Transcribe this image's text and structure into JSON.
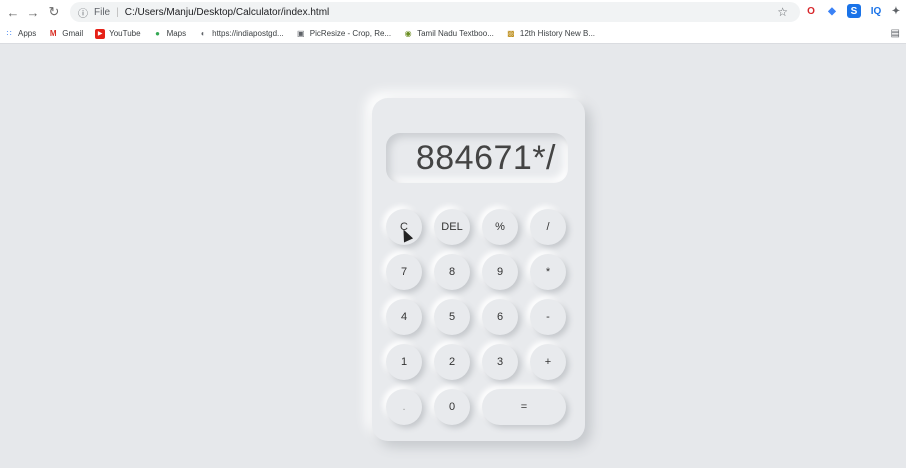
{
  "browser": {
    "file_label": "File",
    "url": "C:/Users/Manju/Desktop/Calculator/index.html",
    "bookmarks": [
      {
        "label": "Apps",
        "icon": "apps-grid-icon"
      },
      {
        "label": "Gmail",
        "icon": "gmail-icon"
      },
      {
        "label": "YouTube",
        "icon": "youtube-icon"
      },
      {
        "label": "Maps",
        "icon": "maps-icon"
      },
      {
        "label": "https://indiapostgd...",
        "icon": "globe-icon"
      },
      {
        "label": "PicResize - Crop, Re...",
        "icon": "picresize-icon"
      },
      {
        "label": "Tamil Nadu Textboo...",
        "icon": "tn-emblem-icon"
      },
      {
        "label": "12th History New B...",
        "icon": "book-icon"
      }
    ],
    "extensions": [
      {
        "label": "O",
        "icon": "opera-icon",
        "color": "#d7262b"
      },
      {
        "label": "◆",
        "icon": "gem-extension-icon",
        "color": "#3b82f6"
      },
      {
        "label": "S",
        "icon": "screenshot-extension-icon",
        "color": "#1a73e8"
      },
      {
        "label": "IQ",
        "icon": "iq-extension-icon",
        "color": "#1a73e8"
      },
      {
        "label": "✦",
        "icon": "puzzle-extensions-icon",
        "color": "#5f6368"
      }
    ]
  },
  "calculator": {
    "display": "884671*/",
    "keys": {
      "clear": "C",
      "del": "DEL",
      "percent": "%",
      "divide": "/",
      "seven": "7",
      "eight": "8",
      "nine": "9",
      "multiply": "*",
      "four": "4",
      "five": "5",
      "six": "6",
      "minus": "-",
      "one": "1",
      "two": "2",
      "three": "3",
      "plus": "+",
      "dot": ".",
      "zero": "0",
      "equals": "="
    }
  }
}
